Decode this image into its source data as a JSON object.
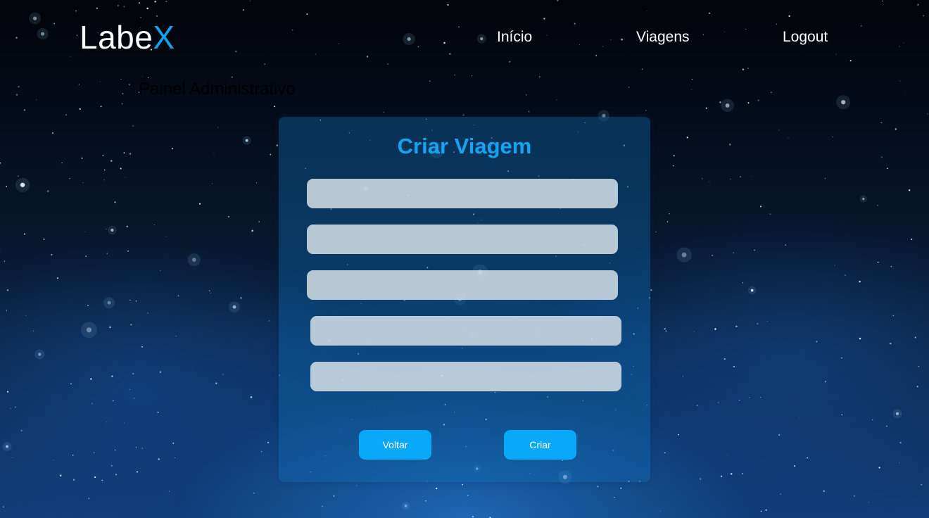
{
  "header": {
    "logo_main": "Labe",
    "logo_accent": "X",
    "nav": {
      "home": "Início",
      "trips": "Viagens",
      "logout": "Logout"
    }
  },
  "page": {
    "subtitle": "Painel Administrativo"
  },
  "form": {
    "title": "Criar Viagem",
    "fields": [
      {
        "value": "",
        "placeholder": ""
      },
      {
        "value": "",
        "placeholder": ""
      },
      {
        "value": "",
        "placeholder": ""
      },
      {
        "value": "",
        "placeholder": ""
      },
      {
        "value": "",
        "placeholder": ""
      }
    ],
    "back_label": "Voltar",
    "create_label": "Criar"
  },
  "colors": {
    "accent": "#12a3f0",
    "button": "#0aa8f8",
    "field_bg": "#d6e1e8"
  }
}
